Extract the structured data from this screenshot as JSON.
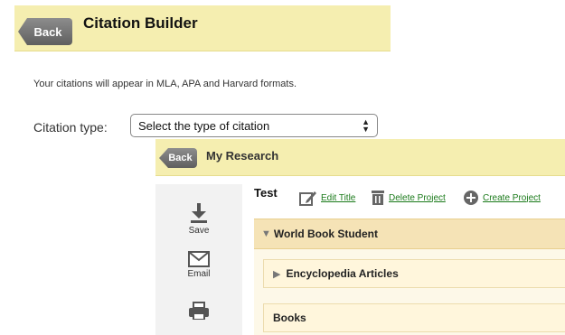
{
  "citation_builder": {
    "back_label": "Back",
    "title": "Citation Builder",
    "note": "Your citations will appear in MLA, APA and Harvard formats.",
    "type_label": "Citation type:",
    "type_select_value": "Select the type of citation"
  },
  "my_research": {
    "back_label": "Back",
    "title": "My Research",
    "sidebar": [
      {
        "icon": "download-icon",
        "label": "Save"
      },
      {
        "icon": "envelope-icon",
        "label": "Email"
      },
      {
        "icon": "printer-icon",
        "label": ""
      }
    ],
    "project_name": "Test",
    "actions": {
      "edit_title": "Edit Title",
      "delete_project": "Delete Project",
      "create_project": "Create Project"
    },
    "group": {
      "title": "World Book Student",
      "items": [
        "Encyclopedia Articles",
        "Books"
      ]
    }
  },
  "colors": {
    "header_bg": "#f5eeb0",
    "group_bg": "#f5e3b6",
    "link_green": "#1a7a1a"
  }
}
